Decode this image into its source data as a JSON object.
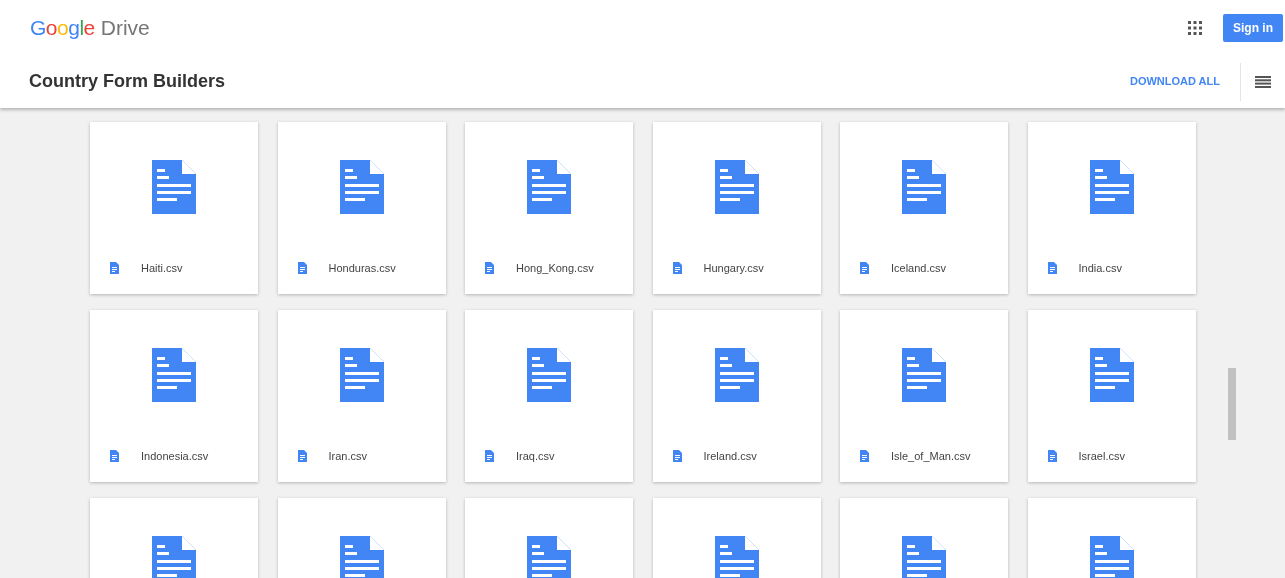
{
  "header": {
    "logo_brand": "Google",
    "logo_product": "Drive",
    "sign_in": "Sign in"
  },
  "toolbar": {
    "title": "Country Form Builders",
    "download_all": "DOWNLOAD ALL"
  },
  "files": [
    {
      "kind": "file",
      "name": "Haiti.csv"
    },
    {
      "kind": "file",
      "name": "Honduras.csv"
    },
    {
      "kind": "file",
      "name": "Hong_Kong.csv"
    },
    {
      "kind": "file",
      "name": "Hungary.csv"
    },
    {
      "kind": "file",
      "name": "Iceland.csv"
    },
    {
      "kind": "file",
      "name": "India.csv"
    },
    {
      "kind": "file",
      "name": "Indonesia.csv"
    },
    {
      "kind": "file",
      "name": "Iran.csv"
    },
    {
      "kind": "file",
      "name": "Iraq.csv"
    },
    {
      "kind": "file",
      "name": "Ireland.csv"
    },
    {
      "kind": "file",
      "name": "Isle_of_Man.csv"
    },
    {
      "kind": "file",
      "name": "Israel.csv"
    },
    {
      "kind": "file"
    },
    {
      "kind": "file"
    },
    {
      "kind": "file"
    },
    {
      "kind": "file"
    },
    {
      "kind": "file"
    },
    {
      "kind": "file"
    }
  ]
}
